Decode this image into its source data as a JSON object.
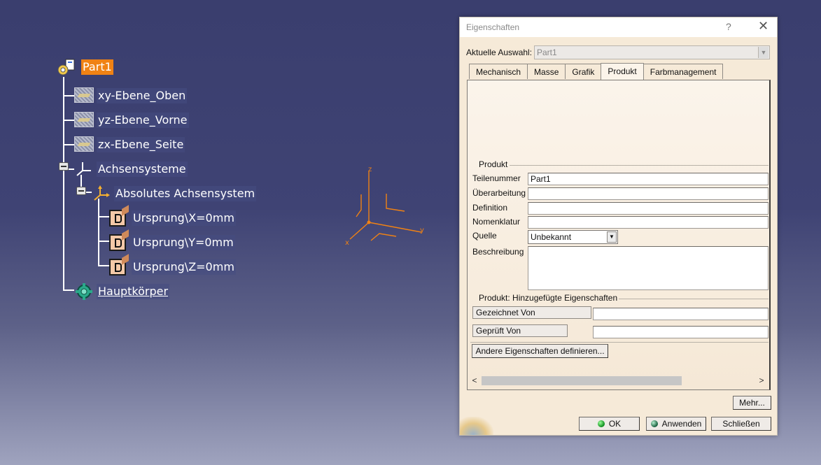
{
  "tree": {
    "root": "Part1",
    "items": [
      {
        "label": "xy-Ebene_Oben",
        "icon": "plane-icon"
      },
      {
        "label": "yz-Ebene_Vorne",
        "icon": "plane-icon"
      },
      {
        "label": "zx-Ebene_Seite",
        "icon": "plane-icon"
      },
      {
        "label": "Achsensysteme",
        "icon": "axis-systems-icon"
      },
      {
        "label": "Absolutes Achsensystem",
        "icon": "axis-system-icon"
      },
      {
        "label": "Ursprung\\X=0mm",
        "icon": "parameter-icon"
      },
      {
        "label": "Ursprung\\Y=0mm",
        "icon": "parameter-icon"
      },
      {
        "label": "Ursprung\\Z=0mm",
        "icon": "parameter-icon"
      },
      {
        "label": "Hauptkörper",
        "icon": "body-icon"
      }
    ]
  },
  "compass": {
    "x": "x",
    "y": "y",
    "z": "z"
  },
  "dialog": {
    "title": "Eigenschaften",
    "help": "?",
    "close": "✕",
    "current_selection_label": "Aktuelle Auswahl:",
    "current_selection_value": "Part1",
    "tabs": [
      "Mechanisch",
      "Masse",
      "Grafik",
      "Produkt",
      "Farbmanagement"
    ],
    "active_tab": "Produkt",
    "product_group": "Produkt",
    "fields": {
      "part_number_label": "Teilenummer",
      "part_number_value": "Part1",
      "revision_label": "Überarbeitung",
      "revision_value": "",
      "definition_label": "Definition",
      "definition_value": "",
      "nomenclature_label": "Nomenklatur",
      "nomenclature_value": "",
      "source_label": "Quelle",
      "source_value": "Unbekannt",
      "description_label": "Beschreibung",
      "description_value": ""
    },
    "added_props_group": "Produkt: Hinzugefügte Eigenschaften",
    "added_props": [
      {
        "label": "Gezeichnet Von",
        "value": ""
      },
      {
        "label": "Geprüft Von",
        "value": ""
      }
    ],
    "define_button": "Andere Eigenschaften definieren...",
    "scroll_left": "<",
    "scroll_right": ">",
    "more_button": "Mehr...",
    "ok_button": "OK",
    "apply_button": "Anwenden",
    "close_button": "Schließen"
  },
  "colors": {
    "selection": "#f08214",
    "dialog_bg": "#f6ead8",
    "compass": "#f08214"
  }
}
